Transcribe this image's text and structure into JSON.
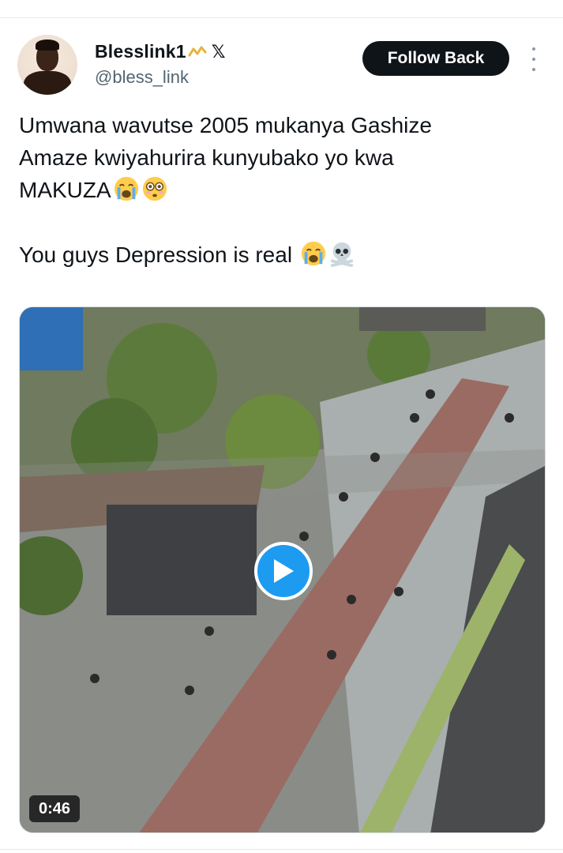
{
  "tweet": {
    "author": {
      "display_name": "Blesslink1",
      "handle": "@bless_link",
      "x_badge": "𝕏"
    },
    "follow_label": "Follow Back",
    "text_lines": [
      "Umwana wavutse 2005 mukanya Gashize",
      "Amaze kwiyahurira kunyubako yo kwa",
      "MAKUZA",
      "You guys Depression is real "
    ],
    "emojis": [
      "loudly-crying-face",
      "flushed-face",
      "loudly-crying-face",
      "skull-and-crossbones"
    ],
    "media": {
      "type": "video",
      "duration": "0:46",
      "play_icon": "play-icon"
    }
  },
  "colors": {
    "primary_text": "#0f1419",
    "secondary_text": "#536471",
    "follow_button_bg": "#0f1419",
    "play_button": "#1d9bf0"
  }
}
